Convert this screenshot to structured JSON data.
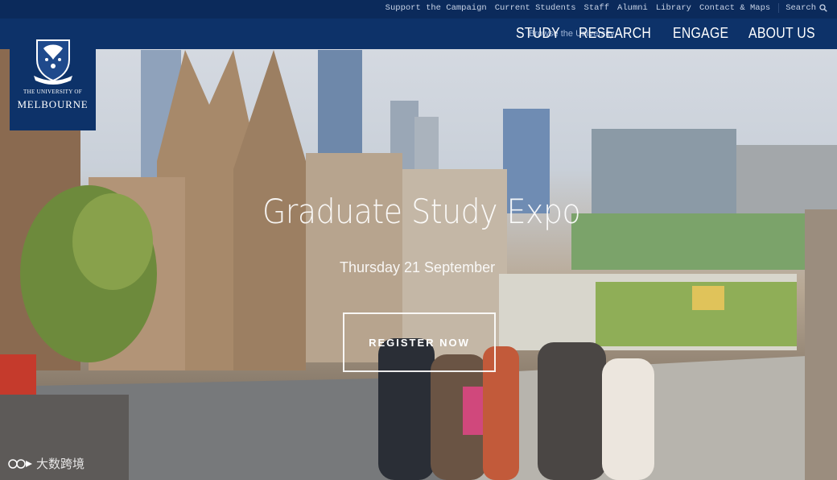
{
  "utility": {
    "links": [
      "Support the Campaign",
      "Current Students",
      "Staff",
      "Alumni",
      "Library",
      "Contact & Maps"
    ],
    "search_label": "Search"
  },
  "nav": {
    "browse_label": "Browse the University",
    "items": [
      "STUDY",
      "RESEARCH",
      "ENGAGE",
      "ABOUT US"
    ]
  },
  "logo": {
    "line1": "THE UNIVERSITY OF",
    "line2": "MELBOURNE"
  },
  "hero": {
    "title": "Graduate Study Expo",
    "date": "Thursday 21 September",
    "cta": "REGISTER NOW"
  },
  "watermark": {
    "text": "大数跨境"
  },
  "colors": {
    "nav_bg": "#0d3269",
    "utility_bg": "#0b2a5b",
    "text": "#ffffff"
  },
  "icons": {
    "search": "search-icon",
    "crest": "crest-icon"
  }
}
